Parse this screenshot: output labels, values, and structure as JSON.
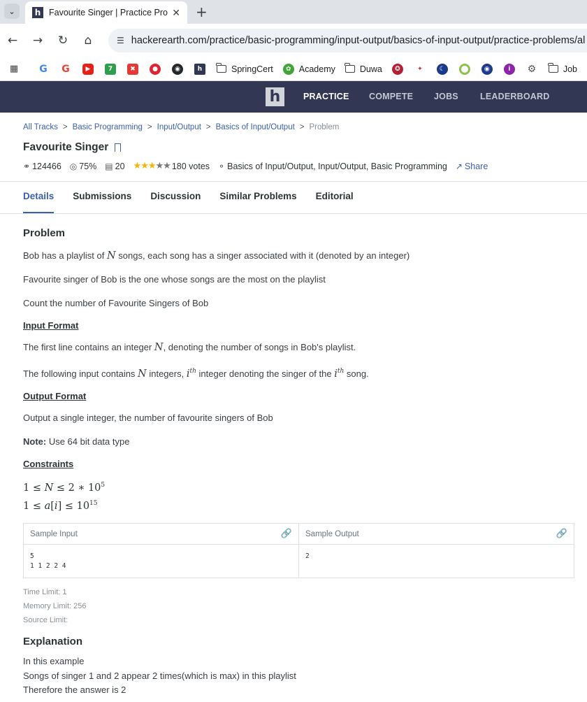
{
  "browser": {
    "tab_title": "Favourite Singer | Practice Prob",
    "url": "hackerearth.com/practice/basic-programming/input-output/basics-of-input-output/practice-problems/al",
    "bookmarks": {
      "springcert": "SpringCert",
      "academy": "Academy",
      "duwa": "Duwa",
      "jobs": "Job"
    }
  },
  "nav": {
    "logo": "h",
    "practice": "PRACTICE",
    "compete": "COMPETE",
    "jobs": "JOBS",
    "leaderboard": "LEADERBOARD"
  },
  "breadcrumb": [
    "All Tracks",
    "Basic Programming",
    "Input/Output",
    "Basics of Input/Output",
    "Problem"
  ],
  "problem": {
    "title": "Favourite Singer",
    "attempts": "124466",
    "success": "75%",
    "submissions": "20",
    "rating": 2.5,
    "votes": "180 votes",
    "tags": "Basics of Input/Output, Input/Output, Basic Programming",
    "share": "Share"
  },
  "tabs": [
    "Details",
    "Submissions",
    "Discussion",
    "Similar Problems",
    "Editorial"
  ],
  "details": {
    "heading": "Problem",
    "p1_a": "Bob has a playlist of ",
    "p1_b": " songs, each song has a singer associated with it (denoted by an integer)",
    "p2": "Favourite singer of Bob is the one whose songs are the most on the playlist",
    "p3": "Count the number of Favourite Singers of Bob",
    "input_format": "Input Format",
    "if1_a": "The first line contains an integer ",
    "if1_b": ", denoting the number of songs in Bob's playlist.",
    "if2_a": "The following input contains ",
    "if2_b": " integers, ",
    "if2_c": " integer denoting the singer of the ",
    "if2_d": " song.",
    "output_format": "Output Format",
    "of1": "Output a single integer, the number of favourite singers of Bob",
    "note_label": "Note:",
    "note_text": " Use 64 bit data type",
    "constraints": "Constraints"
  },
  "samples": {
    "input_label": "Sample Input",
    "output_label": "Sample Output",
    "input": "5\n1 1 2 2 4",
    "output": "2"
  },
  "limits": {
    "time": "Time Limit: 1",
    "memory": "Memory Limit: 256",
    "source": "Source Limit:"
  },
  "explanation": {
    "heading": "Explanation",
    "l1": "In this example",
    "l2": "Songs of singer 1 and 2 appear 2 times(which is max) in this playlist",
    "l3": "Therefore the answer is 2"
  }
}
